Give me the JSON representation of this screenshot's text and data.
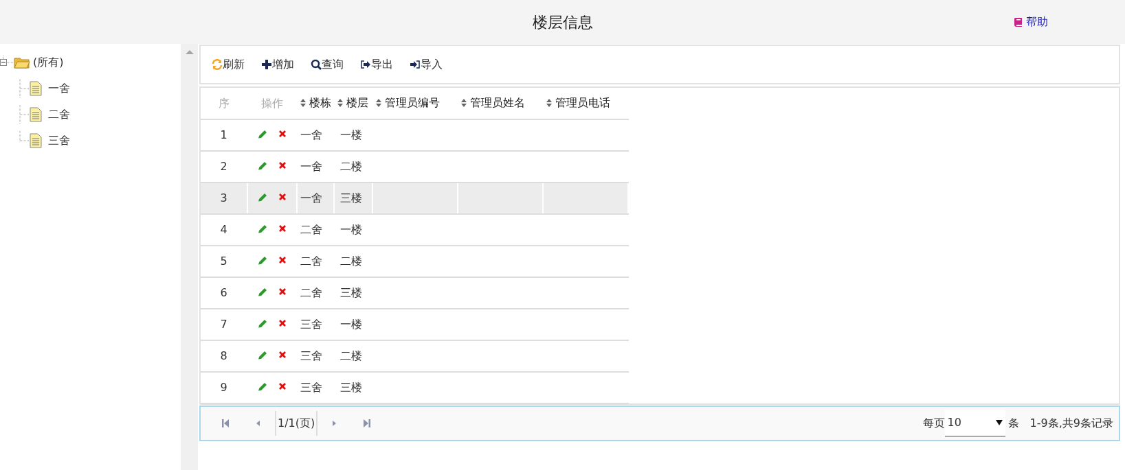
{
  "header": {
    "title": "楼层信息",
    "help": "帮助"
  },
  "tree": {
    "label": "(所有)",
    "expanded": true,
    "children": [
      {
        "label": "一舍"
      },
      {
        "label": "二舍"
      },
      {
        "label": "三舍"
      }
    ]
  },
  "toolbar": [
    {
      "kind": "refresh",
      "label": "刷新"
    },
    {
      "kind": "add",
      "label": "增加"
    },
    {
      "kind": "search",
      "label": "查询"
    },
    {
      "kind": "export",
      "label": "导出"
    },
    {
      "kind": "import",
      "label": "导入"
    }
  ],
  "table": {
    "columns": [
      {
        "label": "序",
        "sortable": false
      },
      {
        "label": "操作",
        "sortable": false
      },
      {
        "label": "楼栋",
        "sortable": true
      },
      {
        "label": "楼层",
        "sortable": true
      },
      {
        "label": "管理员编号",
        "sortable": true
      },
      {
        "label": "管理员姓名",
        "sortable": true
      },
      {
        "label": "管理员电话",
        "sortable": true
      }
    ],
    "rows": [
      {
        "index": "1",
        "building": "一舍",
        "floor": "一楼",
        "selected": false
      },
      {
        "index": "2",
        "building": "一舍",
        "floor": "二楼",
        "selected": false
      },
      {
        "index": "3",
        "building": "一舍",
        "floor": "三楼",
        "selected": true
      },
      {
        "index": "4",
        "building": "二舍",
        "floor": "一楼",
        "selected": false
      },
      {
        "index": "5",
        "building": "二舍",
        "floor": "二楼",
        "selected": false
      },
      {
        "index": "6",
        "building": "二舍",
        "floor": "三楼",
        "selected": false
      },
      {
        "index": "7",
        "building": "三舍",
        "floor": "一楼",
        "selected": false
      },
      {
        "index": "8",
        "building": "三舍",
        "floor": "二楼",
        "selected": false
      },
      {
        "index": "9",
        "building": "三舍",
        "floor": "三楼",
        "selected": false
      }
    ]
  },
  "pager": {
    "page": "1/1(页)",
    "per_page_label": "每页",
    "per_page": "10",
    "unit": "条",
    "summary": "1-9条,共9条记录"
  }
}
